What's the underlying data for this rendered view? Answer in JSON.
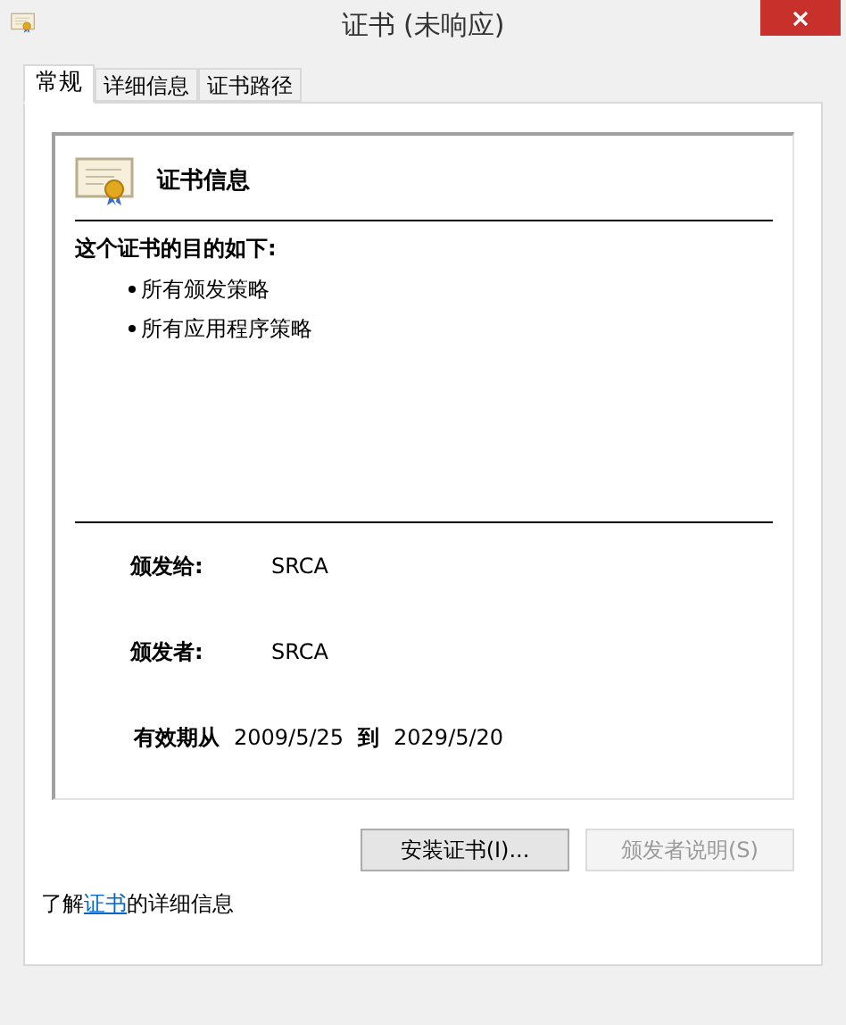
{
  "window": {
    "title": "证书 (未响应)"
  },
  "tabs": [
    {
      "label": "常规",
      "selected": true
    },
    {
      "label": "详细信息",
      "selected": false
    },
    {
      "label": "证书路径",
      "selected": false
    }
  ],
  "certificate": {
    "title": "证书信息",
    "purpose_heading": "这个证书的目的如下:",
    "purposes": [
      "所有颁发策略",
      "所有应用程序策略"
    ],
    "fields": [
      {
        "label": "颁发给:",
        "value": "SRCA"
      },
      {
        "label": "颁发者:",
        "value": "SRCA"
      }
    ],
    "validity": {
      "label": "有效期从",
      "from": "2009/5/25",
      "to_label": "到",
      "to": "2029/5/20"
    }
  },
  "buttons": [
    {
      "label": "安装证书(I)...",
      "disabled": false
    },
    {
      "label": "颁发者说明(S)",
      "disabled": true
    }
  ],
  "footer": {
    "before": "了解",
    "link": "证书",
    "after": "的详细信息"
  }
}
